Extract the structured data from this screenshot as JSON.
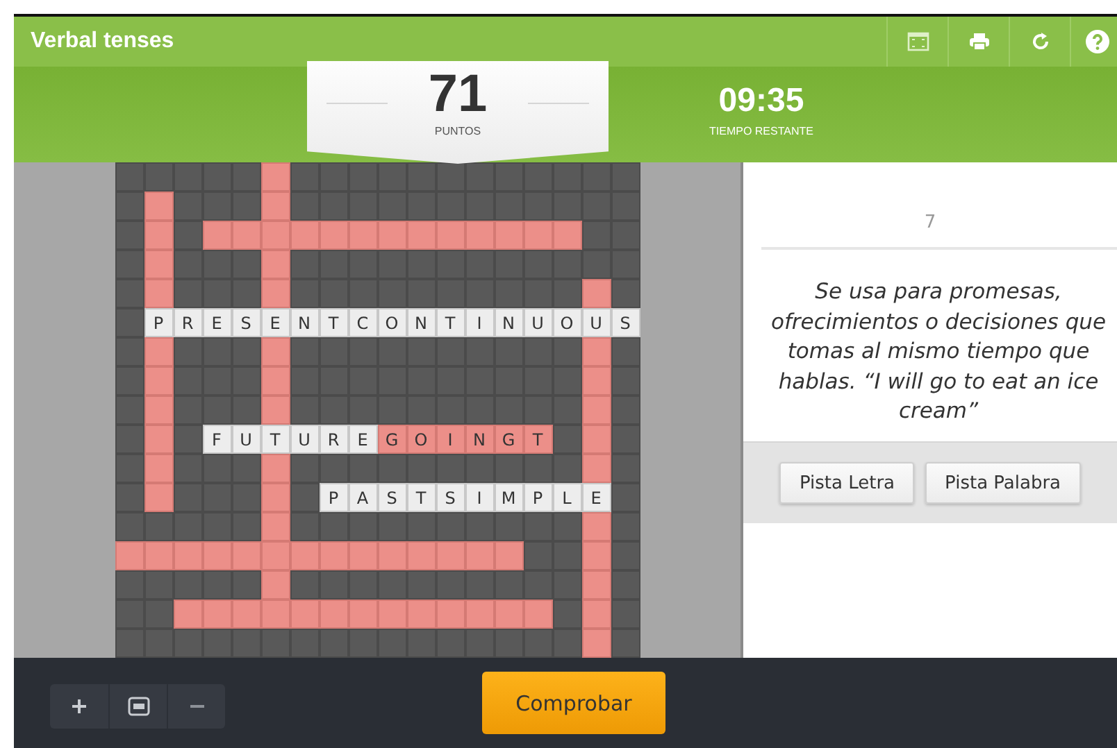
{
  "header": {
    "title": "Verbal tenses"
  },
  "score": {
    "value": "71",
    "label": "PUNTOS"
  },
  "timer": {
    "value": "09:35",
    "label": "TIEMPO RESTANTE"
  },
  "crossword": {
    "rows": [
      [
        {
          "kind": "block"
        },
        {
          "kind": "block"
        },
        {
          "kind": "block"
        },
        {
          "kind": "block"
        },
        {
          "kind": "block"
        },
        {
          "kind": "blank"
        },
        {
          "kind": "block"
        },
        {
          "kind": "block"
        },
        {
          "kind": "block"
        },
        {
          "kind": "block"
        },
        {
          "kind": "block"
        },
        {
          "kind": "block"
        },
        {
          "kind": "block"
        },
        {
          "kind": "block"
        },
        {
          "kind": "block"
        },
        {
          "kind": "block"
        },
        {
          "kind": "block"
        },
        {
          "kind": "block"
        }
      ],
      [
        {
          "kind": "block"
        },
        {
          "kind": "blank"
        },
        {
          "kind": "block"
        },
        {
          "kind": "block"
        },
        {
          "kind": "block"
        },
        {
          "kind": "blank"
        },
        {
          "kind": "block"
        },
        {
          "kind": "block"
        },
        {
          "kind": "block"
        },
        {
          "kind": "block"
        },
        {
          "kind": "block"
        },
        {
          "kind": "block"
        },
        {
          "kind": "block"
        },
        {
          "kind": "block"
        },
        {
          "kind": "block"
        },
        {
          "kind": "block"
        },
        {
          "kind": "block"
        },
        {
          "kind": "block"
        }
      ],
      [
        {
          "kind": "block"
        },
        {
          "kind": "blank"
        },
        {
          "kind": "block"
        },
        {
          "kind": "blank"
        },
        {
          "kind": "blank"
        },
        {
          "kind": "blank"
        },
        {
          "kind": "blank"
        },
        {
          "kind": "blank"
        },
        {
          "kind": "blank"
        },
        {
          "kind": "blank"
        },
        {
          "kind": "blank"
        },
        {
          "kind": "blank"
        },
        {
          "kind": "blank"
        },
        {
          "kind": "blank"
        },
        {
          "kind": "blank"
        },
        {
          "kind": "blank"
        },
        {
          "kind": "block"
        },
        {
          "kind": "block"
        }
      ],
      [
        {
          "kind": "block"
        },
        {
          "kind": "blank"
        },
        {
          "kind": "block"
        },
        {
          "kind": "block"
        },
        {
          "kind": "block"
        },
        {
          "kind": "blank"
        },
        {
          "kind": "block"
        },
        {
          "kind": "block"
        },
        {
          "kind": "block"
        },
        {
          "kind": "block"
        },
        {
          "kind": "block"
        },
        {
          "kind": "block"
        },
        {
          "kind": "block"
        },
        {
          "kind": "block"
        },
        {
          "kind": "block"
        },
        {
          "kind": "block"
        },
        {
          "kind": "block"
        },
        {
          "kind": "block"
        }
      ],
      [
        {
          "kind": "block"
        },
        {
          "kind": "blank"
        },
        {
          "kind": "block"
        },
        {
          "kind": "block"
        },
        {
          "kind": "block"
        },
        {
          "kind": "blank"
        },
        {
          "kind": "block"
        },
        {
          "kind": "block"
        },
        {
          "kind": "block"
        },
        {
          "kind": "block"
        },
        {
          "kind": "block"
        },
        {
          "kind": "block"
        },
        {
          "kind": "block"
        },
        {
          "kind": "block"
        },
        {
          "kind": "block"
        },
        {
          "kind": "block"
        },
        {
          "kind": "blank"
        },
        {
          "kind": "block"
        }
      ],
      [
        {
          "kind": "block"
        },
        {
          "kind": "letter",
          "letter": "P",
          "correct": true
        },
        {
          "kind": "letter",
          "letter": "R",
          "correct": true
        },
        {
          "kind": "letter",
          "letter": "E",
          "correct": true
        },
        {
          "kind": "letter",
          "letter": "S",
          "correct": true
        },
        {
          "kind": "letter",
          "letter": "E",
          "correct": true
        },
        {
          "kind": "letter",
          "letter": "N",
          "correct": true
        },
        {
          "kind": "letter",
          "letter": "T",
          "correct": true
        },
        {
          "kind": "letter",
          "letter": "C",
          "correct": true
        },
        {
          "kind": "letter",
          "letter": "O",
          "correct": true
        },
        {
          "kind": "letter",
          "letter": "N",
          "correct": true
        },
        {
          "kind": "letter",
          "letter": "T",
          "correct": true
        },
        {
          "kind": "letter",
          "letter": "I",
          "correct": true
        },
        {
          "kind": "letter",
          "letter": "N",
          "correct": true
        },
        {
          "kind": "letter",
          "letter": "U",
          "correct": true
        },
        {
          "kind": "letter",
          "letter": "O",
          "correct": true
        },
        {
          "kind": "letter",
          "letter": "U",
          "correct": true
        },
        {
          "kind": "letter",
          "letter": "S",
          "correct": true
        }
      ],
      [
        {
          "kind": "block"
        },
        {
          "kind": "blank"
        },
        {
          "kind": "block"
        },
        {
          "kind": "block"
        },
        {
          "kind": "block"
        },
        {
          "kind": "blank"
        },
        {
          "kind": "block"
        },
        {
          "kind": "block"
        },
        {
          "kind": "block"
        },
        {
          "kind": "block"
        },
        {
          "kind": "block"
        },
        {
          "kind": "block"
        },
        {
          "kind": "block"
        },
        {
          "kind": "block"
        },
        {
          "kind": "block"
        },
        {
          "kind": "block"
        },
        {
          "kind": "blank"
        },
        {
          "kind": "block"
        }
      ],
      [
        {
          "kind": "block"
        },
        {
          "kind": "blank"
        },
        {
          "kind": "block"
        },
        {
          "kind": "block"
        },
        {
          "kind": "block"
        },
        {
          "kind": "blank"
        },
        {
          "kind": "block"
        },
        {
          "kind": "block"
        },
        {
          "kind": "block"
        },
        {
          "kind": "block"
        },
        {
          "kind": "block"
        },
        {
          "kind": "block"
        },
        {
          "kind": "block"
        },
        {
          "kind": "block"
        },
        {
          "kind": "block"
        },
        {
          "kind": "block"
        },
        {
          "kind": "blank"
        },
        {
          "kind": "block"
        }
      ],
      [
        {
          "kind": "block"
        },
        {
          "kind": "blank"
        },
        {
          "kind": "block"
        },
        {
          "kind": "block"
        },
        {
          "kind": "block"
        },
        {
          "kind": "blank"
        },
        {
          "kind": "block"
        },
        {
          "kind": "block"
        },
        {
          "kind": "block"
        },
        {
          "kind": "block"
        },
        {
          "kind": "block"
        },
        {
          "kind": "block"
        },
        {
          "kind": "block"
        },
        {
          "kind": "block"
        },
        {
          "kind": "block"
        },
        {
          "kind": "block"
        },
        {
          "kind": "blank"
        },
        {
          "kind": "block"
        }
      ],
      [
        {
          "kind": "block"
        },
        {
          "kind": "blank"
        },
        {
          "kind": "block"
        },
        {
          "kind": "letter",
          "letter": "F",
          "correct": true
        },
        {
          "kind": "letter",
          "letter": "U",
          "correct": true
        },
        {
          "kind": "letter",
          "letter": "T",
          "correct": true
        },
        {
          "kind": "letter",
          "letter": "U",
          "correct": true
        },
        {
          "kind": "letter",
          "letter": "R",
          "correct": true
        },
        {
          "kind": "letter",
          "letter": "E",
          "correct": true
        },
        {
          "kind": "letter",
          "letter": "G",
          "correct": false
        },
        {
          "kind": "letter",
          "letter": "O",
          "correct": false
        },
        {
          "kind": "letter",
          "letter": "I",
          "correct": false
        },
        {
          "kind": "letter",
          "letter": "N",
          "correct": false
        },
        {
          "kind": "letter",
          "letter": "G",
          "correct": false
        },
        {
          "kind": "letter",
          "letter": "T",
          "correct": false
        },
        {
          "kind": "block"
        },
        {
          "kind": "blank"
        },
        {
          "kind": "block"
        }
      ],
      [
        {
          "kind": "block"
        },
        {
          "kind": "blank"
        },
        {
          "kind": "block"
        },
        {
          "kind": "block"
        },
        {
          "kind": "block"
        },
        {
          "kind": "blank"
        },
        {
          "kind": "block"
        },
        {
          "kind": "block"
        },
        {
          "kind": "block"
        },
        {
          "kind": "block"
        },
        {
          "kind": "block"
        },
        {
          "kind": "block"
        },
        {
          "kind": "block"
        },
        {
          "kind": "block"
        },
        {
          "kind": "block"
        },
        {
          "kind": "block"
        },
        {
          "kind": "blank"
        },
        {
          "kind": "block"
        }
      ],
      [
        {
          "kind": "block"
        },
        {
          "kind": "blank"
        },
        {
          "kind": "block"
        },
        {
          "kind": "block"
        },
        {
          "kind": "block"
        },
        {
          "kind": "blank"
        },
        {
          "kind": "block"
        },
        {
          "kind": "letter",
          "letter": "P",
          "correct": true
        },
        {
          "kind": "letter",
          "letter": "A",
          "correct": true
        },
        {
          "kind": "letter",
          "letter": "S",
          "correct": true
        },
        {
          "kind": "letter",
          "letter": "T",
          "correct": true
        },
        {
          "kind": "letter",
          "letter": "S",
          "correct": true
        },
        {
          "kind": "letter",
          "letter": "I",
          "correct": true
        },
        {
          "kind": "letter",
          "letter": "M",
          "correct": true
        },
        {
          "kind": "letter",
          "letter": "P",
          "correct": true
        },
        {
          "kind": "letter",
          "letter": "L",
          "correct": true
        },
        {
          "kind": "letter",
          "letter": "E",
          "correct": true
        },
        {
          "kind": "block"
        }
      ],
      [
        {
          "kind": "block"
        },
        {
          "kind": "block"
        },
        {
          "kind": "block"
        },
        {
          "kind": "block"
        },
        {
          "kind": "block"
        },
        {
          "kind": "blank"
        },
        {
          "kind": "block"
        },
        {
          "kind": "block"
        },
        {
          "kind": "block"
        },
        {
          "kind": "block"
        },
        {
          "kind": "block"
        },
        {
          "kind": "block"
        },
        {
          "kind": "block"
        },
        {
          "kind": "block"
        },
        {
          "kind": "block"
        },
        {
          "kind": "block"
        },
        {
          "kind": "blank"
        },
        {
          "kind": "block"
        }
      ],
      [
        {
          "kind": "blank"
        },
        {
          "kind": "blank"
        },
        {
          "kind": "blank"
        },
        {
          "kind": "blank"
        },
        {
          "kind": "blank"
        },
        {
          "kind": "blank"
        },
        {
          "kind": "blank"
        },
        {
          "kind": "blank"
        },
        {
          "kind": "blank"
        },
        {
          "kind": "blank"
        },
        {
          "kind": "blank"
        },
        {
          "kind": "blank"
        },
        {
          "kind": "blank"
        },
        {
          "kind": "blank"
        },
        {
          "kind": "block"
        },
        {
          "kind": "block"
        },
        {
          "kind": "blank"
        },
        {
          "kind": "block"
        }
      ],
      [
        {
          "kind": "block"
        },
        {
          "kind": "block"
        },
        {
          "kind": "block"
        },
        {
          "kind": "block"
        },
        {
          "kind": "block"
        },
        {
          "kind": "blank"
        },
        {
          "kind": "block"
        },
        {
          "kind": "block"
        },
        {
          "kind": "block"
        },
        {
          "kind": "block"
        },
        {
          "kind": "block"
        },
        {
          "kind": "block"
        },
        {
          "kind": "block"
        },
        {
          "kind": "block"
        },
        {
          "kind": "block"
        },
        {
          "kind": "block"
        },
        {
          "kind": "blank"
        },
        {
          "kind": "block"
        }
      ],
      [
        {
          "kind": "block"
        },
        {
          "kind": "block"
        },
        {
          "kind": "blank"
        },
        {
          "kind": "blank"
        },
        {
          "kind": "blank"
        },
        {
          "kind": "blank"
        },
        {
          "kind": "blank"
        },
        {
          "kind": "blank"
        },
        {
          "kind": "blank"
        },
        {
          "kind": "blank"
        },
        {
          "kind": "blank"
        },
        {
          "kind": "blank"
        },
        {
          "kind": "blank"
        },
        {
          "kind": "blank"
        },
        {
          "kind": "blank"
        },
        {
          "kind": "block"
        },
        {
          "kind": "blank"
        },
        {
          "kind": "block"
        }
      ],
      [
        {
          "kind": "block"
        },
        {
          "kind": "block"
        },
        {
          "kind": "block"
        },
        {
          "kind": "block"
        },
        {
          "kind": "block"
        },
        {
          "kind": "block"
        },
        {
          "kind": "block"
        },
        {
          "kind": "block"
        },
        {
          "kind": "block"
        },
        {
          "kind": "block"
        },
        {
          "kind": "block"
        },
        {
          "kind": "block"
        },
        {
          "kind": "block"
        },
        {
          "kind": "block"
        },
        {
          "kind": "block"
        },
        {
          "kind": "block"
        },
        {
          "kind": "blank"
        },
        {
          "kind": "block"
        }
      ]
    ]
  },
  "clue": {
    "number": "7",
    "text": "Se usa para promesas, ofrecimientos o decisiones que tomas al mismo tiempo que hablas. “I will go to eat an ice cream”"
  },
  "hint_buttons": [
    "Pista Letra",
    "Pista Palabra"
  ],
  "check_button": "Comprobar"
}
